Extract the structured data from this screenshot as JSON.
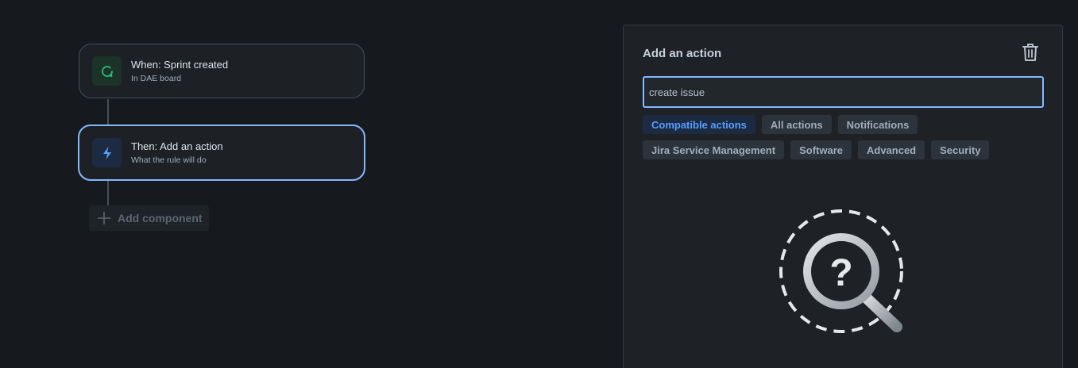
{
  "flow": {
    "trigger": {
      "title": "When: Sprint created",
      "subtitle": "In DAE board",
      "icon": "refresh-icon"
    },
    "action": {
      "title": "Then: Add an action",
      "subtitle": "What the rule will do",
      "icon": "lightning-icon"
    },
    "add_component_label": "Add component"
  },
  "panel": {
    "title": "Add an action",
    "search_value": "create issue",
    "filters_row1": [
      "Compatible actions",
      "All actions",
      "Notifications"
    ],
    "filters_row2": [
      "Jira Service Management",
      "Software",
      "Advanced",
      "Security"
    ],
    "active_filter": "Compatible actions",
    "empty_state_icon": "magnifier-question-icon"
  },
  "colors": {
    "background": "#16191d",
    "accent": "#85b8ff",
    "trigger_icon": "#2abb7f",
    "action_icon": "#579dff"
  }
}
